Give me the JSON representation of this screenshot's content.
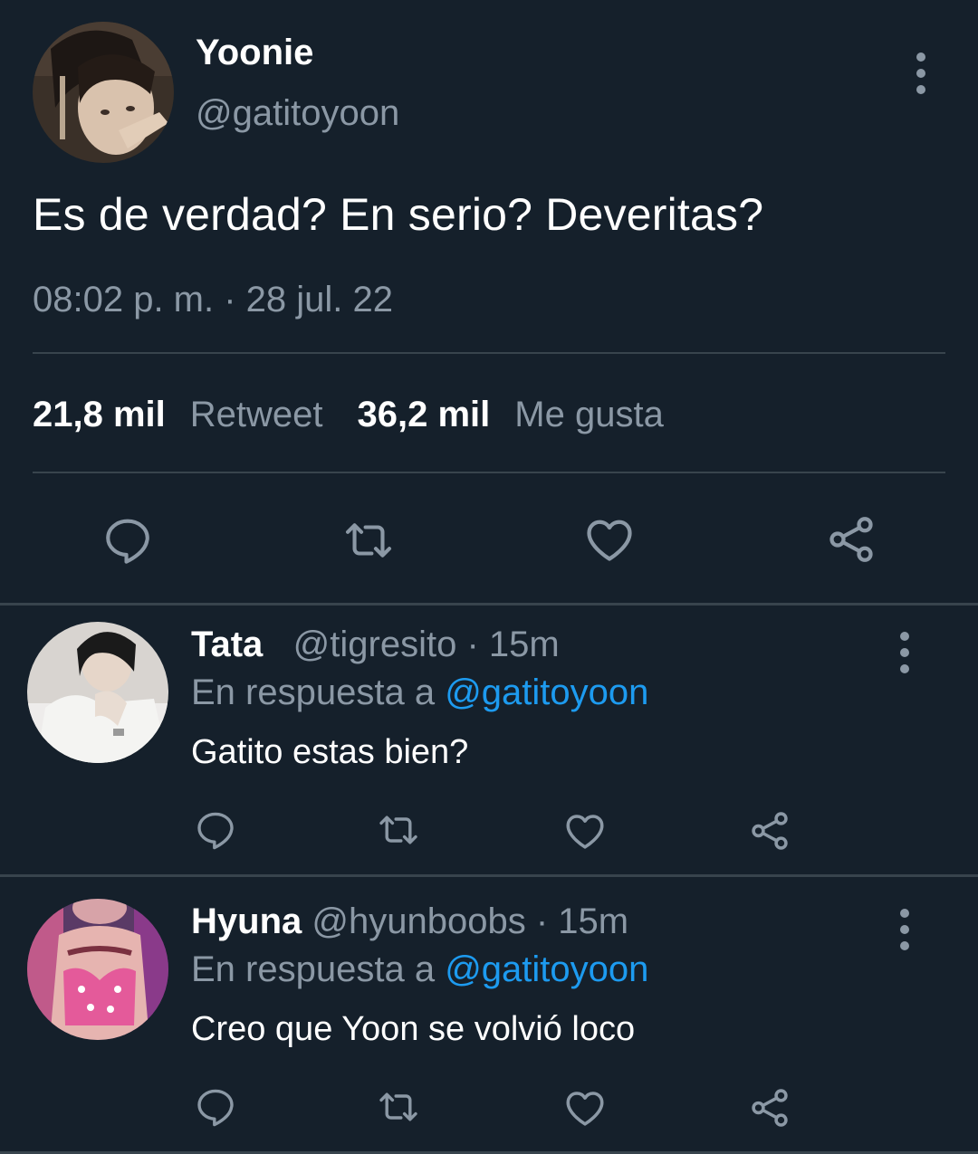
{
  "main_tweet": {
    "display_name": "Yoonie",
    "handle": "@gatitoyoon",
    "text": "Es de verdad? En serio? Deveritas?",
    "timestamp": "08:02 p. m. · 28 jul. 22",
    "retweets_count": "21,8 mil",
    "retweets_label": "Retweet",
    "likes_count": "36,2 mil",
    "likes_label": "Me gusta",
    "actions": [
      "reply-icon",
      "retweet-icon",
      "like-icon",
      "share-icon"
    ]
  },
  "replies": [
    {
      "display_name": "Tata",
      "handle": "@tigresito",
      "time": "15m",
      "separator": "·",
      "reply_prefix": "En respuesta a",
      "reply_to": "@gatitoyoon",
      "text": "Gatito estas bien?"
    },
    {
      "display_name": "Hyuna",
      "handle": "@hyunboobs",
      "time": "15m",
      "separator": "·",
      "reply_prefix": "En respuesta a",
      "reply_to": "@gatitoyoon",
      "text": "Creo que Yoon se volvió loco"
    }
  ],
  "colors": {
    "background": "#15202b",
    "secondary_text": "#8b98a5",
    "divider": "#38444d",
    "mention": "#1d9bf0",
    "primary_text": "#ffffff"
  }
}
